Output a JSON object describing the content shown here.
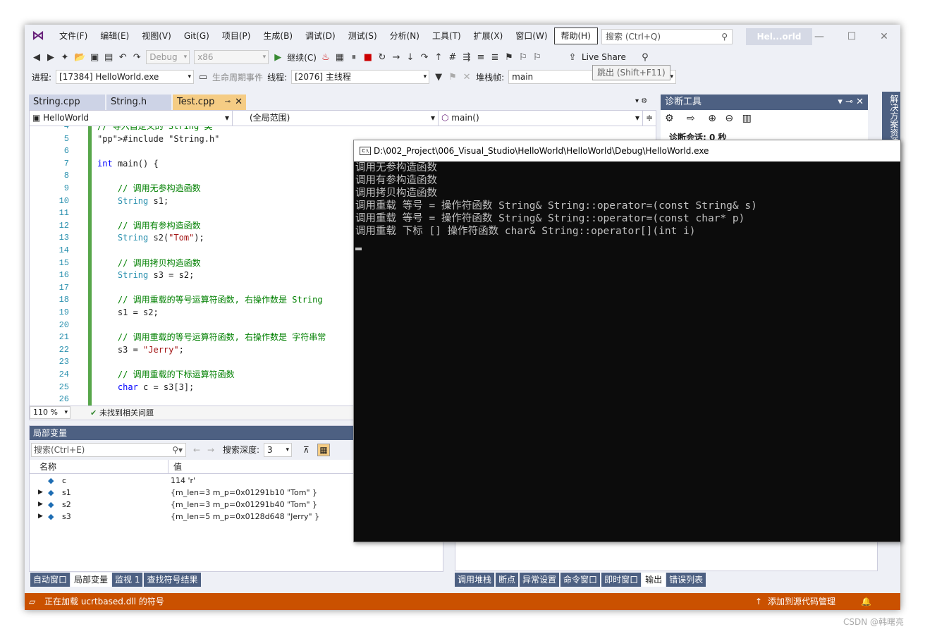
{
  "menubar": {
    "items": [
      "文件(F)",
      "编辑(E)",
      "视图(V)",
      "Git(G)",
      "项目(P)",
      "生成(B)",
      "调试(D)",
      "测试(S)",
      "分析(N)",
      "工具(T)",
      "扩展(X)",
      "窗口(W)",
      "帮助(H)"
    ],
    "search_placeholder": "搜索 (Ctrl+Q)",
    "solution_badge": "Hel...orld"
  },
  "toolbar1": {
    "config": "Debug",
    "platform": "x86",
    "continue_label": "继续(C)",
    "live_share": "Live Share"
  },
  "toolbar2": {
    "process_label": "进程:",
    "process_value": "[17384] HelloWorld.exe",
    "lifecycle_label": "生命周期事件",
    "thread_label": "线程:",
    "thread_value": "[2076] 主线程",
    "stackframe_label": "堆栈帧:",
    "stackframe_value": "main"
  },
  "tooltip": "跳出 (Shift+F11)",
  "tabs": [
    {
      "label": "String.cpp"
    },
    {
      "label": "String.h"
    },
    {
      "label": "Test.cpp"
    }
  ],
  "editor": {
    "project": "HelloWorld",
    "scope": "(全局范围)",
    "function": "main()",
    "zoom": "110 %",
    "status": "未找到相关问题",
    "lines": [
      {
        "n": "4",
        "text": "// 导入自定义的 String 类"
      },
      {
        "n": "5",
        "text": "#include \"String.h\""
      },
      {
        "n": "6",
        "text": ""
      },
      {
        "n": "7",
        "text": "int main() {"
      },
      {
        "n": "8",
        "text": ""
      },
      {
        "n": "9",
        "text": "    // 调用无参构造函数"
      },
      {
        "n": "10",
        "text": "    String s1;"
      },
      {
        "n": "11",
        "text": ""
      },
      {
        "n": "12",
        "text": "    // 调用有参构造函数"
      },
      {
        "n": "13",
        "text": "    String s2(\"Tom\");"
      },
      {
        "n": "14",
        "text": ""
      },
      {
        "n": "15",
        "text": "    // 调用拷贝构造函数"
      },
      {
        "n": "16",
        "text": "    String s3 = s2;"
      },
      {
        "n": "17",
        "text": ""
      },
      {
        "n": "18",
        "text": "    // 调用重载的等号运算符函数, 右操作数是 String"
      },
      {
        "n": "19",
        "text": "    s1 = s2;"
      },
      {
        "n": "20",
        "text": ""
      },
      {
        "n": "21",
        "text": "    // 调用重载的等号运算符函数, 右操作数是 字符串常"
      },
      {
        "n": "22",
        "text": "    s3 = \"Jerry\";"
      },
      {
        "n": "23",
        "text": ""
      },
      {
        "n": "24",
        "text": "    // 调用重载的下标运算符函数"
      },
      {
        "n": "25",
        "text": "    char c = s3[3];"
      },
      {
        "n": "26",
        "text": ""
      }
    ]
  },
  "locals": {
    "title": "局部变量",
    "search_placeholder": "搜索(Ctrl+E)",
    "depth_label": "搜索深度:",
    "depth_value": "3",
    "col_name": "名称",
    "col_value": "值",
    "rows": [
      {
        "name": "c",
        "value": "114 'r'"
      },
      {
        "name": "s1",
        "value": "{m_len=3 m_p=0x01291b10 \"Tom\" }"
      },
      {
        "name": "s2",
        "value": "{m_len=3 m_p=0x01291b40 \"Tom\" }"
      },
      {
        "name": "s3",
        "value": "{m_len=5 m_p=0x0128d648 \"Jerry\" }"
      }
    ]
  },
  "bottom_tabs_left": [
    "自动窗口",
    "局部变量",
    "监视 1",
    "查找符号结果"
  ],
  "bottom_tabs_right": [
    "调用堆栈",
    "断点",
    "异常设置",
    "命令窗口",
    "即时窗口",
    "输出",
    "错误列表"
  ],
  "diag": {
    "title": "诊断工具",
    "session": "诊断会话: 0 秒"
  },
  "right_rail": "解决方案资源",
  "statusbar": {
    "left": "正在加载 ucrtbased.dll 的符号",
    "right": "添加到源代码管理"
  },
  "console": {
    "title": "D:\\002_Project\\006_Visual_Studio\\HelloWorld\\HelloWorld\\Debug\\HelloWorld.exe",
    "lines": [
      "调用无参构造函数",
      "调用有参构造函数",
      "调用拷贝构造函数",
      "调用重载 等号 = 操作符函数 String& String::operator=(const String& s)",
      "调用重载 等号 = 操作符函数 String& String::operator=(const char* p)",
      "调用重载 下标 [] 操作符函数 char& String::operator[](int i)"
    ]
  },
  "watermark": "CSDN @韩曙亮"
}
